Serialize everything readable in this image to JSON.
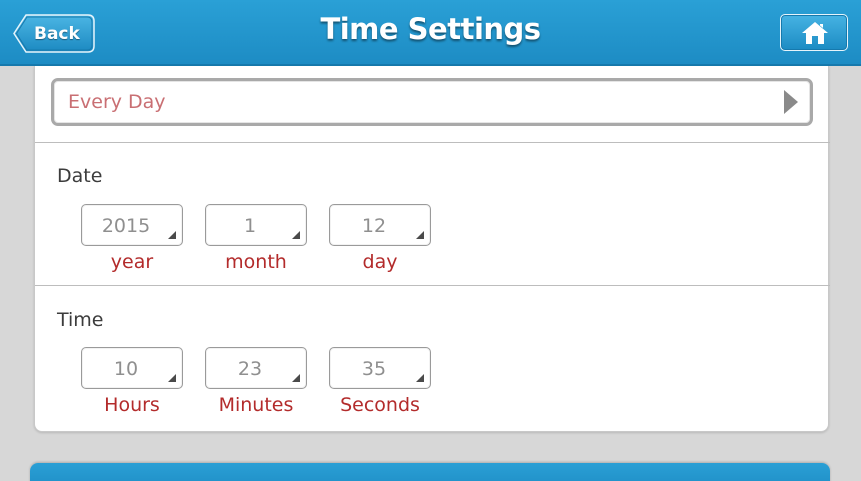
{
  "header": {
    "title": "Time Settings",
    "back_label": "Back",
    "home_icon": "home-icon"
  },
  "repeat": {
    "value": "Every Day",
    "arrow_icon": "play-arrow-icon"
  },
  "date": {
    "label": "Date",
    "year": {
      "value": "2015",
      "caption": "year"
    },
    "month": {
      "value": "1",
      "caption": "month"
    },
    "day": {
      "value": "12",
      "caption": "day"
    }
  },
  "time": {
    "label": "Time",
    "hours": {
      "value": "10",
      "caption": "Hours"
    },
    "minutes": {
      "value": "23",
      "caption": "Minutes"
    },
    "seconds": {
      "value": "35",
      "caption": "Seconds"
    }
  },
  "colors": {
    "header_blue": "#1d8cc4",
    "caption_red": "#b32b2b",
    "repeat_text": "#c96f73",
    "background": "#d7d7d7"
  }
}
